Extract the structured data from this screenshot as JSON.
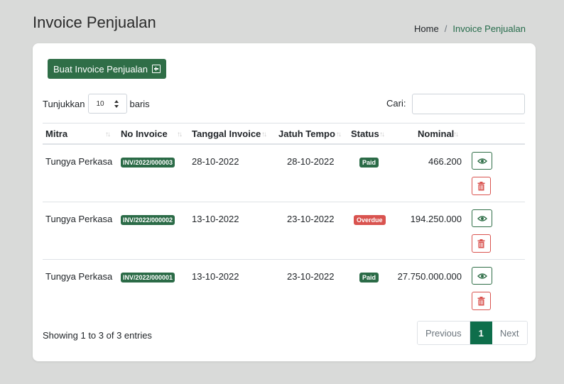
{
  "header": {
    "title": "Invoice Penjualan",
    "breadcrumb": {
      "home": "Home",
      "separator": "/",
      "current": "Invoice Penjualan"
    }
  },
  "toolbar": {
    "create_label": "Buat Invoice Penjualan",
    "create_icon": "plus-square-icon"
  },
  "length_menu": {
    "prefix": "Tunjukkan",
    "value": "10",
    "suffix": "baris"
  },
  "search": {
    "label": "Cari:",
    "value": "",
    "placeholder": ""
  },
  "table": {
    "columns": [
      "Mitra",
      "No Invoice",
      "Tanggal Invoice",
      "Jatuh Tempo",
      "Status",
      "Nominal"
    ],
    "rows": [
      {
        "mitra": "Tungya Perkasa",
        "no_invoice": "INV/2022/000003",
        "tanggal": "28-10-2022",
        "jatuh_tempo": "28-10-2022",
        "status": "Paid",
        "nominal": "466.200"
      },
      {
        "mitra": "Tungya Perkasa",
        "no_invoice": "INV/2022/000002",
        "tanggal": "13-10-2022",
        "jatuh_tempo": "23-10-2022",
        "status": "Overdue",
        "nominal": "194.250.000"
      },
      {
        "mitra": "Tungya Perkasa",
        "no_invoice": "INV/2022/000001",
        "tanggal": "13-10-2022",
        "jatuh_tempo": "23-10-2022",
        "status": "Paid",
        "nominal": "27.750.000.000"
      }
    ]
  },
  "footer": {
    "info": "Showing 1 to 3 of 3 entries"
  },
  "pagination": {
    "previous": "Previous",
    "current": "1",
    "next": "Next"
  },
  "colors": {
    "primary": "#2f6e47",
    "active_page": "#0e6e4b",
    "danger": "#d9534f",
    "background": "#d9dad9"
  }
}
